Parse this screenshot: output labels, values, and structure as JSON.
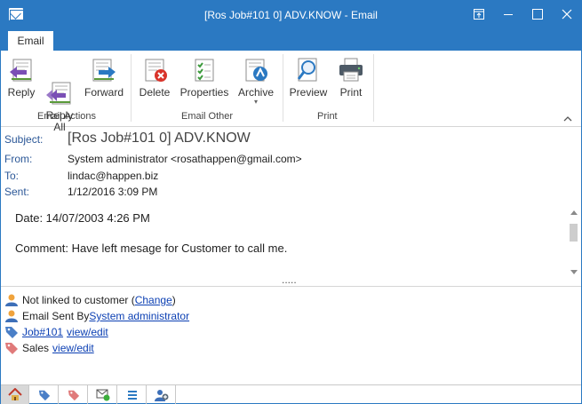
{
  "window": {
    "title": "[Ros Job#101 0] ADV.KNOW - Email"
  },
  "tabs": [
    {
      "label": "Email",
      "selected": true
    }
  ],
  "ribbon": {
    "groups": [
      {
        "label": "Email Actions",
        "buttons": [
          {
            "label": "Reply",
            "icon": "reply-icon"
          },
          {
            "label": "Reply\nAll",
            "icon": "reply-all-icon"
          },
          {
            "label": "Forward",
            "icon": "forward-icon"
          }
        ]
      },
      {
        "label": "Email Other",
        "buttons": [
          {
            "label": "Delete",
            "icon": "delete-icon"
          },
          {
            "label": "Properties",
            "icon": "properties-icon"
          },
          {
            "label": "Archive",
            "icon": "archive-icon"
          }
        ]
      },
      {
        "label": "Print",
        "buttons": [
          {
            "label": "Preview",
            "icon": "preview-icon"
          },
          {
            "label": "Print",
            "icon": "print-icon"
          }
        ]
      }
    ]
  },
  "header": {
    "subject_label": "Subject:",
    "subject": "[Ros Job#101 0] ADV.KNOW",
    "from_label": "From:",
    "from": "System administrator <rosathappen@gmail.com>",
    "to_label": "To:",
    "to": "lindac@happen.biz",
    "sent_label": "Sent:",
    "sent": "1/12/2016 3:09 PM"
  },
  "body": {
    "lines": [
      "Date: 14/07/2003 4:26 PM",
      "Comment: Have left mesage for Customer to call me."
    ],
    "splitter": "....."
  },
  "info": {
    "customer_prefix": "Not linked to customer (",
    "customer_link": "Change",
    "customer_suffix": ")",
    "sent_by_prefix": "Email Sent By ",
    "sent_by_link": "System administrator",
    "job_link": "Job#101",
    "job_view_link": "view/edit",
    "sales_label": "Sales",
    "sales_view_link": "view/edit"
  },
  "bottom_tabs": [
    {
      "icon": "home-icon",
      "active": true
    },
    {
      "icon": "tag-blue-icon",
      "active": false
    },
    {
      "icon": "tag-red-icon",
      "active": false
    },
    {
      "icon": "email-status-icon",
      "active": false
    },
    {
      "icon": "list-icon",
      "active": false
    },
    {
      "icon": "contacts-icon",
      "active": false
    }
  ],
  "colors": {
    "titlebar": "#2b79c2",
    "label_blue": "#2b5797",
    "link": "#0b3fb3"
  }
}
